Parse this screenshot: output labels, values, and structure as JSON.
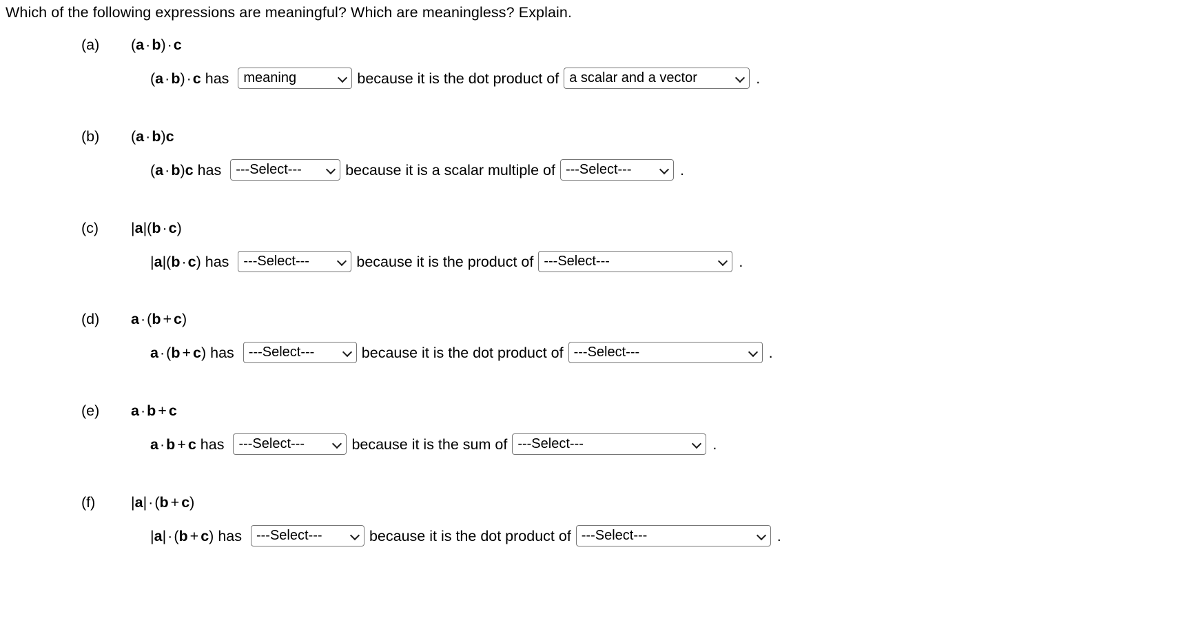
{
  "prompt": "Which of the following expressions are meaningful? Which are meaningless? Explain.",
  "parts": [
    {
      "label": "(a)",
      "expression_plain": "(a · b) · c",
      "sentence_lead": " has ",
      "select1_value": "meaning",
      "middle_text": "because it is the dot product of",
      "select2_value": "a scalar and a vector",
      "period": "."
    },
    {
      "label": "(b)",
      "expression_plain": "(a · b)c",
      "sentence_lead": " has ",
      "select1_value": "---Select---",
      "middle_text": "because it is a scalar multiple of",
      "select2_value": "---Select---",
      "period": "."
    },
    {
      "label": "(c)",
      "expression_plain": "|a|(b · c)",
      "sentence_lead": " has ",
      "select1_value": "---Select---",
      "middle_text": "because it is the product of",
      "select2_value": "---Select---",
      "period": "."
    },
    {
      "label": "(d)",
      "expression_plain": "a · (b + c)",
      "sentence_lead": " has ",
      "select1_value": "---Select---",
      "middle_text": "because it is the dot product of",
      "select2_value": "---Select---",
      "period": "."
    },
    {
      "label": "(e)",
      "expression_plain": "a · b + c",
      "sentence_lead": " has ",
      "select1_value": "---Select---",
      "middle_text": "because it is the sum of",
      "select2_value": "---Select---",
      "period": "."
    },
    {
      "label": "(f)",
      "expression_plain": "|a| · (b + c)",
      "sentence_lead": " has ",
      "select1_value": "---Select---",
      "middle_text": "because it is the dot product of",
      "select2_value": "---Select---",
      "period": "."
    }
  ],
  "icons": {
    "dropdown_chevron": "chevron-down-icon"
  },
  "colors": {
    "text": "#000000",
    "select_border": "#767676",
    "background": "#ffffff"
  }
}
